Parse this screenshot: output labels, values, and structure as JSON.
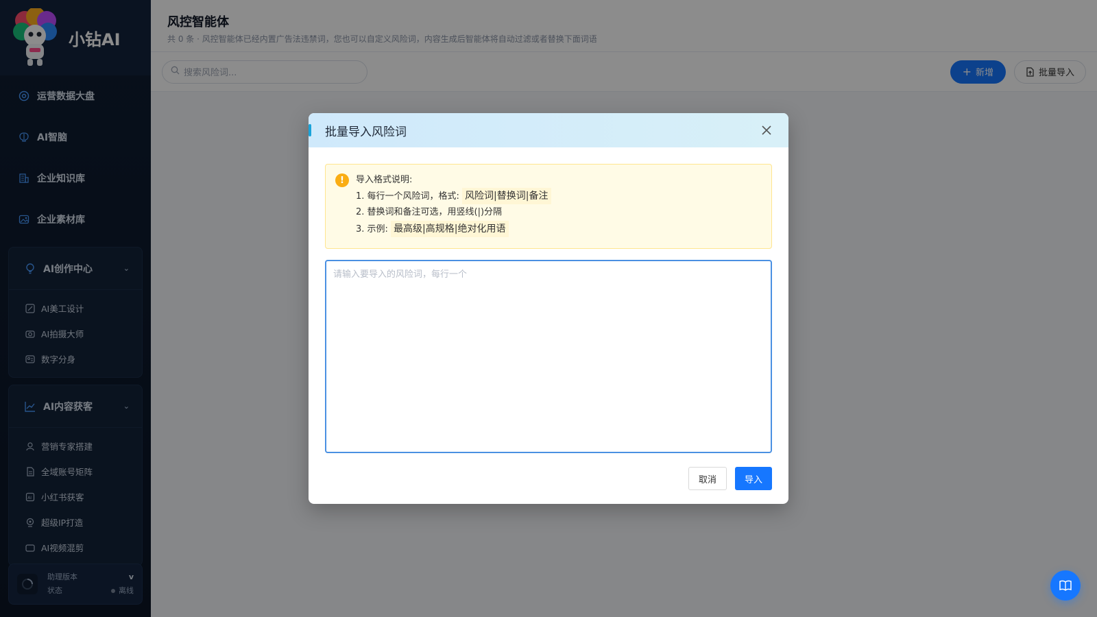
{
  "brand": {
    "name": "小钻AI",
    "logo_badge": "小钻石"
  },
  "nav": [
    {
      "label": "运营数据大盘",
      "icon": "dashboard-icon"
    },
    {
      "label": "AI智脑",
      "icon": "brain-icon"
    },
    {
      "label": "企业知识库",
      "icon": "building-icon"
    },
    {
      "label": "企业素材库",
      "icon": "image-icon"
    }
  ],
  "groups": [
    {
      "label": "AI创作中心",
      "icon": "bulb-icon",
      "items": [
        {
          "label": "AI美工设计",
          "icon": "design-icon"
        },
        {
          "label": "AI拍摄大师",
          "icon": "camera-icon"
        },
        {
          "label": "数字分身",
          "icon": "avatar-icon"
        }
      ]
    },
    {
      "label": "AI内容获客",
      "icon": "trend-icon",
      "items": [
        {
          "label": "营销专家搭建",
          "icon": "user-icon"
        },
        {
          "label": "全域账号矩阵",
          "icon": "file-icon"
        },
        {
          "label": "小红书获客",
          "icon": "ai-icon"
        },
        {
          "label": "超级IP打造",
          "icon": "ip-icon"
        },
        {
          "label": "AI视频混剪",
          "icon": "video-icon"
        }
      ]
    }
  ],
  "status": {
    "title": "助理版本",
    "state_label": "状态",
    "version": "v",
    "state": "离线"
  },
  "page": {
    "title": "风控智能体",
    "subtitle": "共 0 条 · 风控智能体已经内置广告法违禁词，您也可以自定义风险词，内容生成后智能体将自动过滤或者替换下面词语",
    "search_placeholder": "搜索风险词...",
    "new_label": "新增",
    "import_label": "批量导入"
  },
  "modal": {
    "title": "批量导入风险词",
    "notice_title": "导入格式说明:",
    "line1_prefix": "1. 每行一个风险词，格式:",
    "line1_code": "风险词|替换词|备注",
    "line2": "2. 替换词和备注可选，用竖线(|)分隔",
    "line3_prefix": "3. 示例:",
    "line3_code": "最高级|高规格|绝对化用语",
    "textarea_placeholder": "请输入要导入的风险词，每行一个",
    "cancel_label": "取消",
    "ok_label": "导入"
  },
  "colors": {
    "primary": "#1677ff",
    "sidebar_bg": "#0f1e33",
    "warning": "#faad14"
  }
}
